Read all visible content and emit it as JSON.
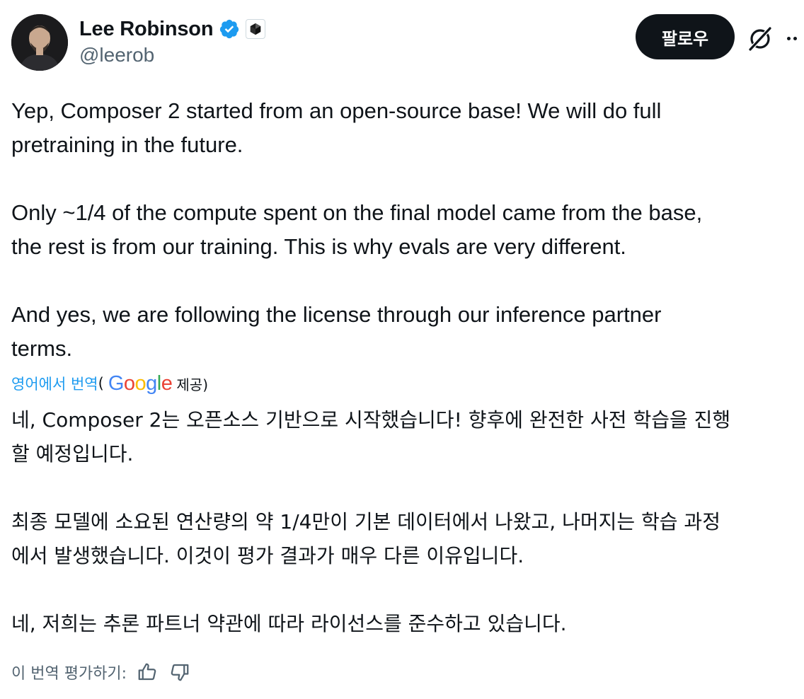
{
  "author": {
    "display_name": "Lee Robinson",
    "handle": "@leerob",
    "verified": true,
    "avatar_icon": "profile-photo"
  },
  "actions": {
    "follow_label": "팔로우",
    "grok_icon": "grok-icon",
    "more_icon": "more-icon"
  },
  "tweet": {
    "paragraphs": [
      {
        "line1": "Yep, Composer 2 started from an open-source base! We will do full",
        "line2": "pretraining in the future."
      },
      {
        "line1": "Only ~1/4 of the compute spent on the final model came from the base,",
        "line2": "the rest is from our training. This is why evals are very different."
      },
      {
        "line1": "And yes, we are following the license through our inference partner",
        "line2": "terms."
      }
    ]
  },
  "translation": {
    "link_label": "영어에서 번역",
    "open_paren": "(",
    "provider": "Google",
    "provided_label": "제공)",
    "paragraphs": [
      {
        "line1": "네, Composer 2는 오픈소스 기반으로 시작했습니다! 향후에 완전한 사전 학습을 진행",
        "line2": "할 예정입니다."
      },
      {
        "line1": "최종 모델에 소요된 연산량의 약 1/4만이 기본 데이터에서 나왔고, 나머지는 학습 과정",
        "line2": "에서 발생했습니다. 이것이 평가 결과가 매우 다른 이유입니다."
      },
      {
        "line1": "네, 저희는 추론 파트너 약관에 따라 라이선스를 준수하고 있습니다."
      }
    ],
    "rate_label": "이 번역 평가하기:"
  },
  "colors": {
    "text": "#0f1419",
    "secondary": "#536471",
    "link": "#1d9bf0",
    "verified": "#1d9bf0",
    "button_bg": "#0f1419"
  }
}
